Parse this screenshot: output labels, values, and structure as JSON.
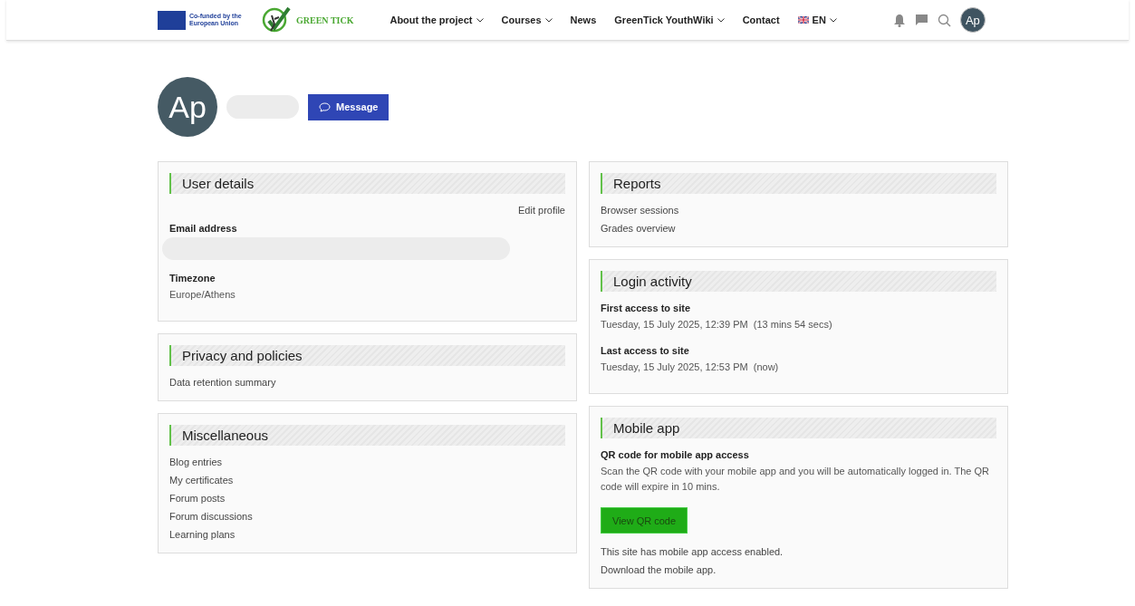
{
  "header": {
    "eu_text": "Co-funded by the European Union",
    "brand": "GREEN TICK",
    "nav": [
      {
        "label": "About the project",
        "dropdown": true
      },
      {
        "label": "Courses",
        "dropdown": true
      },
      {
        "label": "News",
        "dropdown": false
      },
      {
        "label": "GreenTick YouthWiki",
        "dropdown": true
      },
      {
        "label": "Contact",
        "dropdown": false
      }
    ],
    "language": "EN",
    "avatar": "Ap"
  },
  "profile": {
    "avatar": "Ap",
    "message_button": "Message"
  },
  "columns": [
    [
      {
        "title": "User details",
        "items": [
          {
            "kind": "action",
            "text": "Edit profile"
          },
          {
            "kind": "field_redacted",
            "label": "Email address"
          },
          {
            "kind": "field",
            "label": "Timezone",
            "value": "Europe/Athens"
          }
        ]
      },
      {
        "title": "Privacy and policies",
        "items": [
          {
            "kind": "link",
            "text": "Data retention summary"
          }
        ]
      },
      {
        "title": "Miscellaneous",
        "items": [
          {
            "kind": "link",
            "text": "Blog entries"
          },
          {
            "kind": "link",
            "text": "My certificates"
          },
          {
            "kind": "link",
            "text": "Forum posts"
          },
          {
            "kind": "link",
            "text": "Forum discussions"
          },
          {
            "kind": "link",
            "text": "Learning plans"
          }
        ]
      }
    ],
    [
      {
        "title": "Reports",
        "items": [
          {
            "kind": "link",
            "text": "Browser sessions"
          },
          {
            "kind": "link",
            "text": "Grades overview"
          }
        ]
      },
      {
        "title": "Login activity",
        "items": [
          {
            "kind": "field",
            "label": "First access to site",
            "value": "Tuesday, 15 July 2025, 12:39 PM  (13 mins 54 secs)"
          },
          {
            "kind": "field",
            "label": "Last access to site",
            "value": "Tuesday, 15 July 2025, 12:53 PM  (now)"
          }
        ]
      },
      {
        "title": "Mobile app",
        "items": [
          {
            "kind": "field",
            "label": "QR code for mobile app access",
            "value": "Scan the QR code with your mobile app and you will be automatically logged in. The QR code will expire in 10 mins."
          },
          {
            "kind": "button",
            "text": "View QR code"
          },
          {
            "kind": "text",
            "text": "This site has mobile app access enabled."
          },
          {
            "kind": "link",
            "text": "Download the mobile app."
          }
        ]
      }
    ]
  ]
}
